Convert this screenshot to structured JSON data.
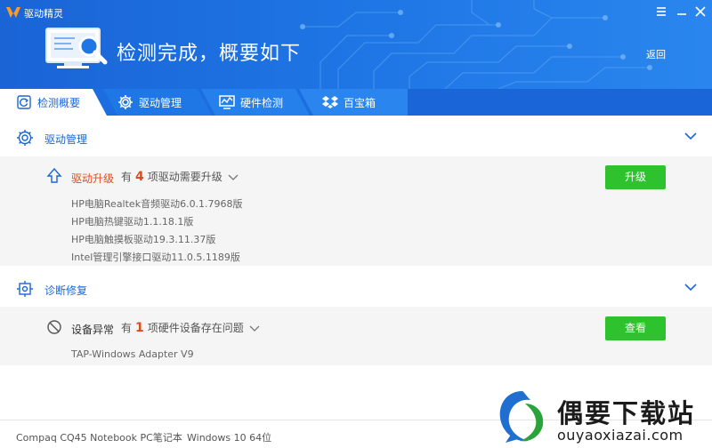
{
  "window": {
    "app_title": "驱动精灵",
    "menu_icon": "menu-icon",
    "minimize_icon": "minimize-icon",
    "close_icon": "close-icon"
  },
  "header": {
    "title": "检测完成，概要如下",
    "back_label": "返回",
    "art_icon": "monitor-magnifier-icon"
  },
  "tabs": [
    {
      "label": "检测概要",
      "icon": "refresh-icon",
      "active": true
    },
    {
      "label": "驱动管理",
      "icon": "gear-icon",
      "active": false
    },
    {
      "label": "硬件检测",
      "icon": "monitor-chart-icon",
      "active": false
    },
    {
      "label": "百宝箱",
      "icon": "dropbox-icon",
      "active": false
    }
  ],
  "sections": {
    "drivers": {
      "title": "驱动管理",
      "icon": "gear-icon",
      "row": {
        "title": "驱动升级",
        "desc_prefix": "有",
        "count": "4",
        "desc_suffix": "项驱动需要升级",
        "button": "升级",
        "icon": "upgrade-arrow-icon"
      },
      "items": [
        "HP电脑Realtek音频驱动6.0.1.7968版",
        "HP电脑热键驱动1.1.18.1版",
        "HP电脑触摸板驱动19.3.11.37版",
        "Intel管理引擎接口驱动11.0.5.1189版"
      ]
    },
    "repair": {
      "title": "诊断修复",
      "icon": "diagnose-icon",
      "row": {
        "title": "设备异常",
        "desc_prefix": "有",
        "count": "1",
        "desc_suffix": "项硬件设备存在问题",
        "button": "查看",
        "icon": "prohibited-icon"
      },
      "items": [
        "TAP-Windows Adapter V9"
      ]
    }
  },
  "footer": {
    "model": "Compaq CQ45 Notebook PC笔记本",
    "os": "Windows 10 64位"
  },
  "watermark": {
    "title": "偶要下载站",
    "url": "ouyaoxiazai.com"
  },
  "colors": {
    "header_blue": "#1f77e6",
    "accent_blue": "#1a66d8",
    "warning_red": "#e24a1c",
    "button_green": "#2ec22e",
    "panel_gray": "#f5f5f5"
  }
}
